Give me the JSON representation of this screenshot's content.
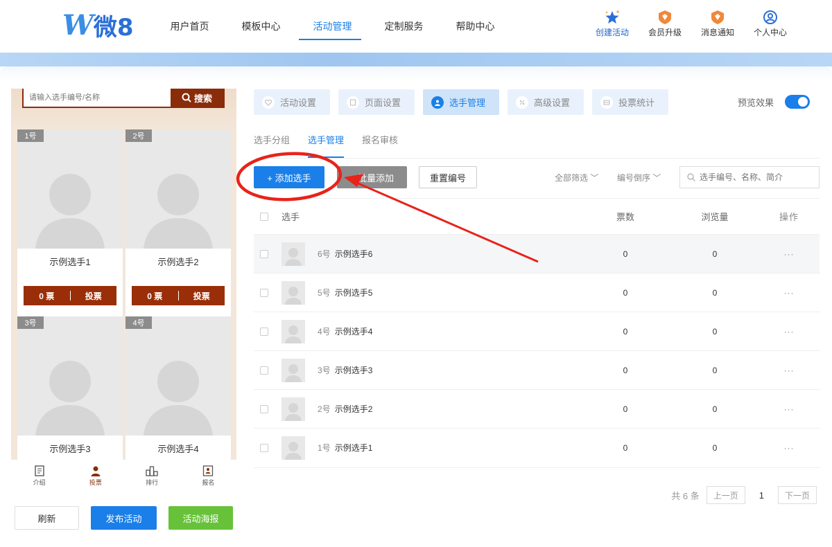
{
  "header": {
    "logo_text": "微8",
    "nav": [
      {
        "label": "用户首页",
        "active": false
      },
      {
        "label": "模板中心",
        "active": false
      },
      {
        "label": "活动管理",
        "active": true
      },
      {
        "label": "定制服务",
        "active": false
      },
      {
        "label": "帮助中心",
        "active": false
      }
    ],
    "actions": [
      {
        "label": "创建活动",
        "icon": "star-icon"
      },
      {
        "label": "会员升级",
        "icon": "member-badge-icon"
      },
      {
        "label": "消息通知",
        "icon": "bell-badge-icon"
      },
      {
        "label": "个人中心",
        "icon": "user-circle-icon"
      }
    ]
  },
  "preview": {
    "search_placeholder": "请输入选手编号/名称",
    "search_button": "搜索",
    "cards": [
      {
        "badge": "1号",
        "name": "示例选手1",
        "votes": "0 票",
        "vote_button": "投票"
      },
      {
        "badge": "2号",
        "name": "示例选手2",
        "votes": "0 票",
        "vote_button": "投票"
      },
      {
        "badge": "3号",
        "name": "示例选手3"
      },
      {
        "badge": "4号",
        "name": "示例选手4"
      }
    ],
    "tabbar": [
      {
        "label": "介绍",
        "icon": "document-icon"
      },
      {
        "label": "投票",
        "icon": "person-icon",
        "active": true
      },
      {
        "label": "排行",
        "icon": "rank-icon"
      },
      {
        "label": "报名",
        "icon": "signup-icon"
      }
    ],
    "buttons": {
      "refresh": "刷新",
      "publish": "发布活动",
      "poster": "活动海报"
    }
  },
  "main": {
    "top_tabs": [
      {
        "label": "活动设置",
        "icon": "heart-icon"
      },
      {
        "label": "页面设置",
        "icon": "page-icon"
      },
      {
        "label": "选手管理",
        "icon": "player-icon",
        "active": true
      },
      {
        "label": "高级设置",
        "icon": "advanced-icon"
      },
      {
        "label": "投票统计",
        "icon": "stats-icon"
      }
    ],
    "preview_toggle_label": "预览效果",
    "preview_toggle_on": true,
    "sub_tabs": [
      {
        "label": "选手分组"
      },
      {
        "label": "选手管理",
        "active": true
      },
      {
        "label": "报名审核"
      }
    ],
    "actions": {
      "add": "+ 添加选手",
      "batch": "+ 批量添加",
      "reset": "重置编号",
      "filter_all": "全部筛选",
      "sort": "编号倒序",
      "search_placeholder": "选手编号、名称、简介"
    },
    "table": {
      "columns": [
        "选手",
        "票数",
        "浏览量",
        "操作"
      ],
      "rows": [
        {
          "num": "6号",
          "name": "示例选手6",
          "votes": "0",
          "views": "0",
          "op": "···"
        },
        {
          "num": "5号",
          "name": "示例选手5",
          "votes": "0",
          "views": "0",
          "op": "···"
        },
        {
          "num": "4号",
          "name": "示例选手4",
          "votes": "0",
          "views": "0",
          "op": "···"
        },
        {
          "num": "3号",
          "name": "示例选手3",
          "votes": "0",
          "views": "0",
          "op": "···"
        },
        {
          "num": "2号",
          "name": "示例选手2",
          "votes": "0",
          "views": "0",
          "op": "···"
        },
        {
          "num": "1号",
          "name": "示例选手1",
          "votes": "0",
          "views": "0",
          "op": "···"
        }
      ]
    },
    "pagination": {
      "total": "共 6 条",
      "prev": "上一页",
      "current": "1",
      "next": "下一页"
    }
  },
  "colors": {
    "accent": "#1a7fe8",
    "vote_brown": "#9a2e08",
    "poster_green": "#67c23a",
    "annotation_red": "#e8231a"
  }
}
